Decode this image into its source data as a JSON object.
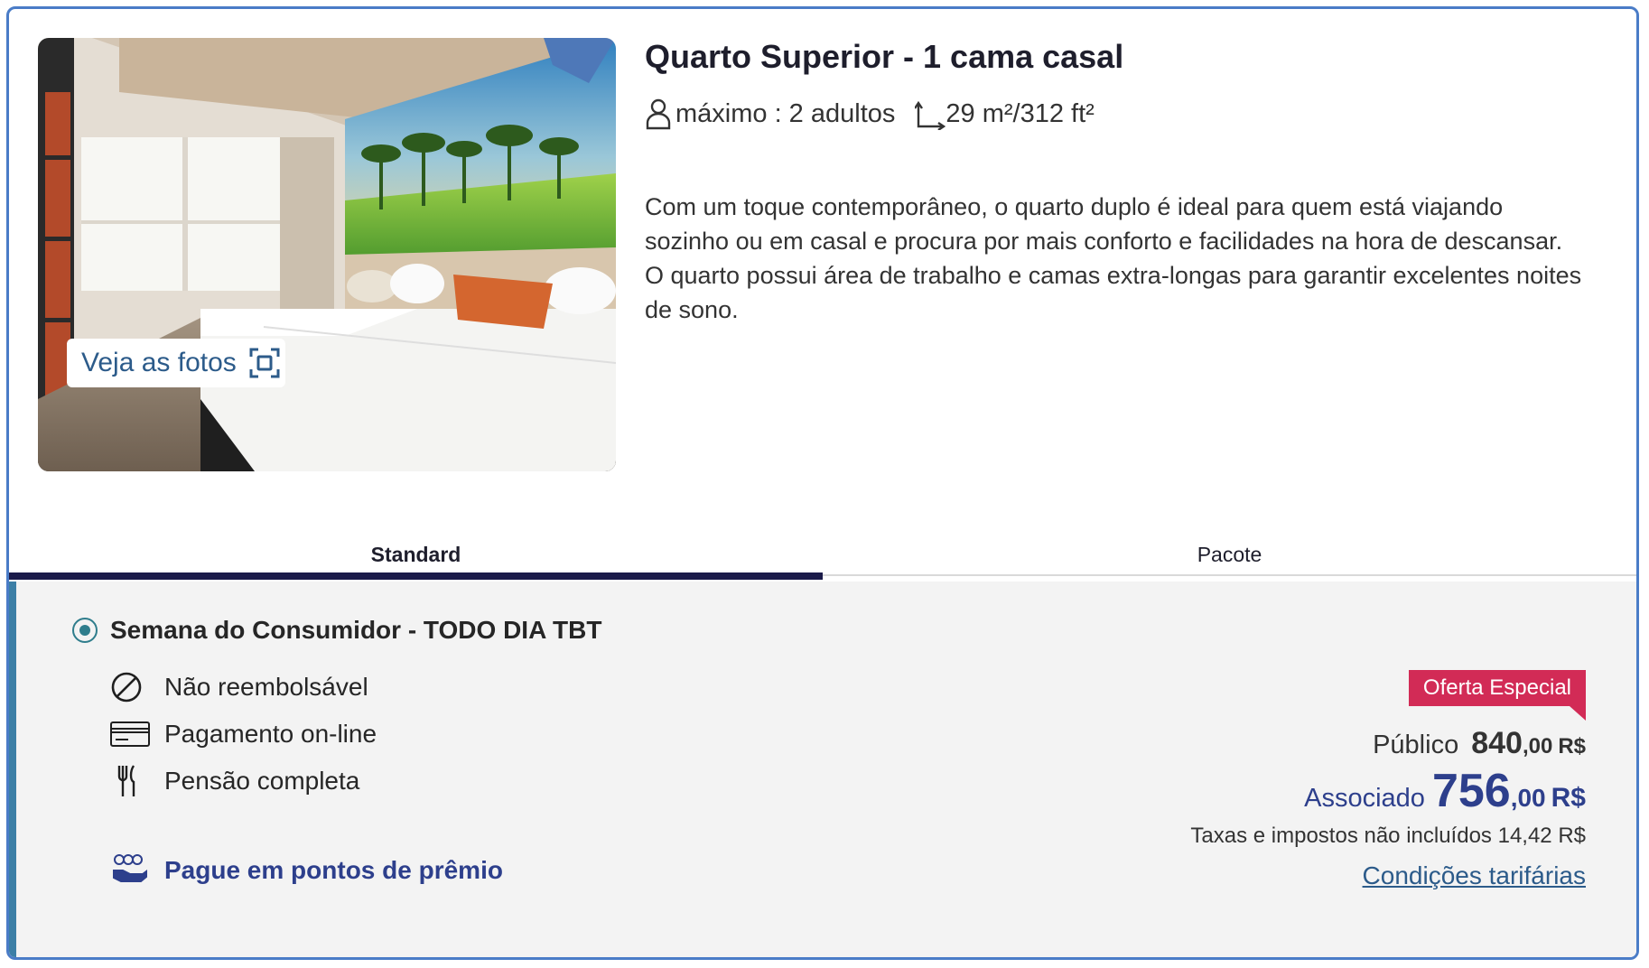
{
  "room": {
    "title": "Quarto Superior - 1 cama casal",
    "occupancy": "máximo : 2 adultos",
    "area": "29 m²/312 ft²",
    "description": "Com um toque contemporâneo, o quarto duplo é ideal para quem está viajando sozinho ou em casal e procura por mais conforto e facilidades na hora de descansar. O quarto possui área de trabalho e camas extra-longas para garantir excelentes noites de sono.",
    "photos_button": "Veja as fotos"
  },
  "tabs": [
    {
      "label": "Standard",
      "active": true
    },
    {
      "label": "Pacote",
      "active": false
    }
  ],
  "rate": {
    "name": "Semana do Consumidor - TODO DIA TBT",
    "features": [
      {
        "icon": "no-refund-icon",
        "label": "Não reembolsável"
      },
      {
        "icon": "credit-card-icon",
        "label": "Pagamento on-line"
      },
      {
        "icon": "fork-knife-icon",
        "label": "Pensão completa"
      }
    ],
    "points_link": "Pague em pontos de prêmio",
    "badge": "Oferta Especial",
    "public_label": "Público",
    "public_price_int": "840",
    "public_price_dec": ",00",
    "public_currency": "R$",
    "member_label": "Associado",
    "member_price_int": "756",
    "member_price_dec": ",00",
    "member_currency": "R$",
    "taxes": "Taxas e impostos não incluídos 14,42 R$",
    "conditions_link": "Condições tarifárias"
  },
  "colors": {
    "accent_navy": "#2d3f8c",
    "badge_red": "#d22b56",
    "card_border": "#4a7cc7",
    "radio_teal": "#2f7d8c"
  }
}
